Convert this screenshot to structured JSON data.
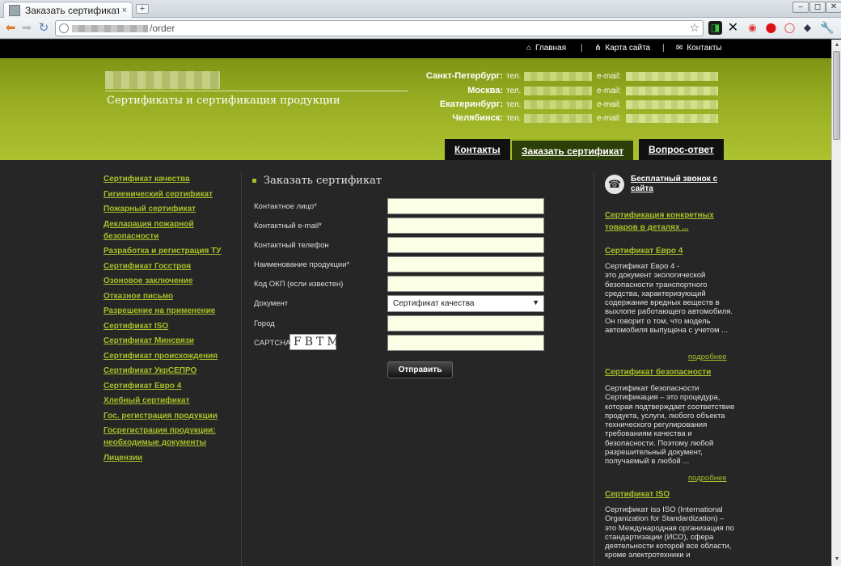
{
  "browser": {
    "tab_title": "Заказать сертификат / ...",
    "tab_close": "×",
    "newtab": "+",
    "url_path": "/order",
    "win_min": "–",
    "win_max": "◻",
    "win_close": "✕"
  },
  "topnav": {
    "home": "Главная",
    "sitemap": "Карта сайта",
    "contacts": "Контакты",
    "sep": "|"
  },
  "header": {
    "slogan": "Сертификаты и сертификация продукции",
    "cities": [
      {
        "name": "Санкт-Петербург:",
        "tel": "тел.",
        "email": "e-mail:"
      },
      {
        "name": "Москва:",
        "tel": "тел.",
        "email": "e-mail:"
      },
      {
        "name": "Екатеринбург:",
        "tel": "тел.",
        "email": "e-mail:"
      },
      {
        "name": "Челябинск:",
        "tel": "тел.",
        "email": "e-mail:"
      }
    ],
    "tabs": [
      "Контакты",
      "Заказать сертификат",
      "Вопрос-ответ"
    ]
  },
  "leftnav": [
    "Сертификат качества",
    "Гигиенический сертификат",
    "Пожарный сертификат",
    "Декларация пожарной безопасности",
    "Разработка и регистрация ТУ",
    "Сертификат Госстроя",
    "Озоновое заключение",
    "Отказное письмо",
    "Разрешение на применение",
    "Сертификат ISO",
    "Сертификат Минсвязи",
    "Сертификат происхождения",
    "Сертификат УкрСЕПРО",
    "Сертификат Евро 4",
    "Хлебный сертификат",
    "Гос. регистрация продукции",
    "Госрегистрация продукции: необходимые документы",
    "Лицензии"
  ],
  "form": {
    "title": "Заказать сертификат",
    "labels": {
      "contact": "Контактное лицо*",
      "email": "Контактный e-mail*",
      "phone": "Контактный телефон",
      "product": "Наименование продукции*",
      "okp": "Код ОКП (если известен)",
      "document": "Документ",
      "city": "Город",
      "captcha": "CAPTCHA"
    },
    "document_selected": "Сертификат качества",
    "captcha_text": "FBTM",
    "submit": "Отправить"
  },
  "sidebar": {
    "callback": "Бесплатный звонок с сайта",
    "promo": "Сертификация конкретных товаров в деталях ...",
    "more": "подробнее",
    "articles": [
      {
        "title": "Сертификат Евро 4",
        "text": "Сертификат Евро 4 -\nэто документ экологической безопасности транспортного средства, характеризующий  содержание вредных веществ в выхлопе работающего автомобиля. Он говорит о том, что модель автомобиля выпущена с учетом ..."
      },
      {
        "title": "Сертификат безопасности",
        "text": "Сертификат безопасности\n Сертификация  – это процедура, которая  подтверждает соответствие продукта, услуги, любого объекта технического регулирования  требованиям качества и безопасности. Поэтому любой разрешительный документ, получаемый в любой ..."
      },
      {
        "title": "Сертификат ISO",
        "text": "Сертификат iso  ISO (International Organization for Standardization) – это Международная организация по стандартизации (ИСО), сфера деятельности которой все области, кроме электротехники и"
      }
    ]
  },
  "colors": {
    "accent": "#a8c028",
    "header_green": "#9aae24",
    "background": "#262626"
  }
}
